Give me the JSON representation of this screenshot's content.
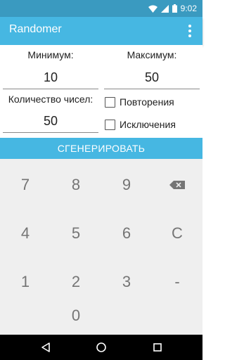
{
  "status_bar": {
    "time": "9:02",
    "icons": [
      "wifi-icon",
      "cell-signal-icon",
      "battery-icon"
    ]
  },
  "app_bar": {
    "title": "Randomer",
    "menu_icon": "more-vert-icon"
  },
  "form": {
    "min_label": "Минимум:",
    "min_value": "10",
    "max_label": "Максимум:",
    "max_value": "50",
    "count_label": "Количество чисел:",
    "count_value": "50",
    "repeats_label": "Повторения",
    "repeats_checked": false,
    "exclusions_label": "Исключения",
    "exclusions_checked": false
  },
  "generate_button": "СГЕНЕРИРОВАТЬ",
  "keypad": {
    "k7": "7",
    "k8": "8",
    "k9": "9",
    "backspace_icon": "backspace-icon",
    "k4": "4",
    "k5": "5",
    "k6": "6",
    "clear": "C",
    "k1": "1",
    "k2": "2",
    "k3": "3",
    "minus": "-",
    "k0": "0"
  },
  "nav_bar": {
    "icons": [
      "back-icon",
      "home-icon",
      "recents-icon"
    ]
  },
  "colors": {
    "status_bar": "#3a9ac0",
    "accent": "#46b7e2",
    "keypad_bg": "#efefef",
    "key_text": "#757575"
  }
}
